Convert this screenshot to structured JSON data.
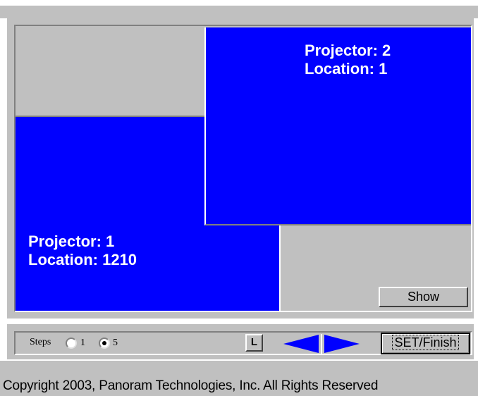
{
  "canvas": {
    "projectors": [
      {
        "projector_line": "Projector: 1",
        "location_line": "Location: 1210"
      },
      {
        "projector_line": "Projector: 2",
        "location_line": "Location: 1"
      }
    ],
    "show_label": "Show"
  },
  "controls": {
    "steps_label": "Steps",
    "step_options": [
      {
        "label": "1",
        "selected": false
      },
      {
        "label": "5",
        "selected": true
      }
    ],
    "l_label": "L",
    "set_finish_label": "SET/Finish",
    "left_arrow_icon": "arrow-left-icon",
    "right_arrow_icon": "arrow-right-icon"
  },
  "footer": {
    "copyright": "Copyright 2003, Panoram Technologies, Inc. All Rights Reserved"
  },
  "colors": {
    "projector_fill": "#0000ff",
    "panel_gray": "#c0c0c0",
    "arrow": "#0000ff"
  }
}
